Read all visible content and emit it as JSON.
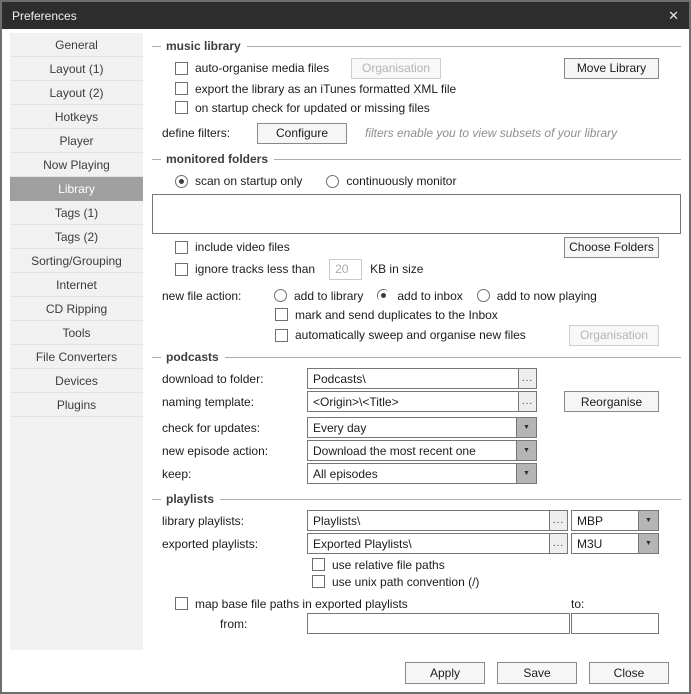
{
  "window": {
    "title": "Preferences"
  },
  "icons": {
    "close": "✕",
    "dropdown_arrow": "▼",
    "browse_ellipsis": "..."
  },
  "sidebar": {
    "selected_item": "Library",
    "items": [
      "General",
      "Layout (1)",
      "Layout (2)",
      "Hotkeys",
      "Player",
      "Now Playing",
      "Library",
      "Tags (1)",
      "Tags (2)",
      "Sorting/Grouping",
      "Internet",
      "CD Ripping",
      "Tools",
      "File Converters",
      "Devices",
      "Plugins"
    ]
  },
  "music_library": {
    "section_title": "music library",
    "auto_organise_label": "auto-organise media files",
    "organisation_button": "Organisation",
    "move_library_button": "Move Library",
    "export_itunes_label": "export the library as an iTunes formatted XML file",
    "startup_check_label": "on startup check for updated or missing files",
    "define_filters_label": "define filters:",
    "configure_button": "Configure",
    "filters_hint": "filters enable you to view subsets of your library"
  },
  "monitored_folders": {
    "section_title": "monitored folders",
    "scan_startup_label": "scan on startup only",
    "continuous_label": "continuously monitor",
    "scan_mode_selected": "scan on startup only",
    "include_video_label": "include video files",
    "choose_folders_button": "Choose Folders",
    "ignore_tracks_label": "ignore tracks less than",
    "ignore_size_value": "20",
    "ignore_size_unit": "KB in size",
    "new_file_action_label": "new file action:",
    "add_to_library_label": "add to library",
    "add_to_inbox_label": "add to inbox",
    "add_to_now_playing_label": "add to now playing",
    "new_file_action_selected": "add to inbox",
    "mark_duplicates_label": "mark and send duplicates to the Inbox",
    "auto_sweep_label": "automatically sweep and organise new files",
    "organisation_button": "Organisation"
  },
  "podcasts": {
    "section_title": "podcasts",
    "download_folder_label": "download to folder:",
    "download_folder_value": "Podcasts\\",
    "naming_template_label": "naming template:",
    "naming_template_value": "<Origin>\\<Title>",
    "reorganise_button": "Reorganise",
    "check_updates_label": "check for updates:",
    "check_updates_value": "Every day",
    "new_episode_label": "new episode action:",
    "new_episode_value": "Download the most recent one",
    "keep_label": "keep:",
    "keep_value": "All episodes"
  },
  "playlists": {
    "section_title": "playlists",
    "library_playlists_label": "library playlists:",
    "library_playlists_value": "Playlists\\",
    "library_playlists_format": "MBP",
    "exported_playlists_label": "exported playlists:",
    "exported_playlists_value": "Exported Playlists\\",
    "exported_playlists_format": "M3U",
    "relative_paths_label": "use relative file paths",
    "unix_paths_label": "use unix path convention (/)",
    "map_paths_label": "map base file paths in exported playlists",
    "to_label": "to:",
    "from_label": "from:"
  },
  "footer": {
    "apply_button": "Apply",
    "save_button": "Save",
    "close_button": "Close"
  }
}
